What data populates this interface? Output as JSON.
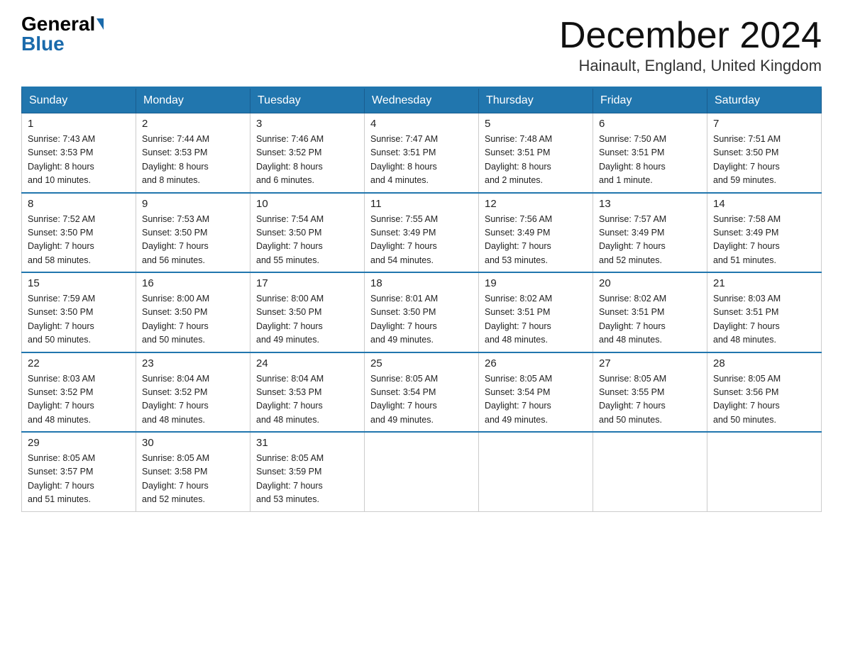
{
  "header": {
    "logo_general": "General",
    "logo_blue": "Blue",
    "title": "December 2024",
    "subtitle": "Hainault, England, United Kingdom"
  },
  "weekdays": [
    "Sunday",
    "Monday",
    "Tuesday",
    "Wednesday",
    "Thursday",
    "Friday",
    "Saturday"
  ],
  "weeks": [
    [
      {
        "day": "1",
        "sunrise": "7:43 AM",
        "sunset": "3:53 PM",
        "daylight": "8 hours and 10 minutes."
      },
      {
        "day": "2",
        "sunrise": "7:44 AM",
        "sunset": "3:53 PM",
        "daylight": "8 hours and 8 minutes."
      },
      {
        "day": "3",
        "sunrise": "7:46 AM",
        "sunset": "3:52 PM",
        "daylight": "8 hours and 6 minutes."
      },
      {
        "day": "4",
        "sunrise": "7:47 AM",
        "sunset": "3:51 PM",
        "daylight": "8 hours and 4 minutes."
      },
      {
        "day": "5",
        "sunrise": "7:48 AM",
        "sunset": "3:51 PM",
        "daylight": "8 hours and 2 minutes."
      },
      {
        "day": "6",
        "sunrise": "7:50 AM",
        "sunset": "3:51 PM",
        "daylight": "8 hours and 1 minute."
      },
      {
        "day": "7",
        "sunrise": "7:51 AM",
        "sunset": "3:50 PM",
        "daylight": "7 hours and 59 minutes."
      }
    ],
    [
      {
        "day": "8",
        "sunrise": "7:52 AM",
        "sunset": "3:50 PM",
        "daylight": "7 hours and 58 minutes."
      },
      {
        "day": "9",
        "sunrise": "7:53 AM",
        "sunset": "3:50 PM",
        "daylight": "7 hours and 56 minutes."
      },
      {
        "day": "10",
        "sunrise": "7:54 AM",
        "sunset": "3:50 PM",
        "daylight": "7 hours and 55 minutes."
      },
      {
        "day": "11",
        "sunrise": "7:55 AM",
        "sunset": "3:49 PM",
        "daylight": "7 hours and 54 minutes."
      },
      {
        "day": "12",
        "sunrise": "7:56 AM",
        "sunset": "3:49 PM",
        "daylight": "7 hours and 53 minutes."
      },
      {
        "day": "13",
        "sunrise": "7:57 AM",
        "sunset": "3:49 PM",
        "daylight": "7 hours and 52 minutes."
      },
      {
        "day": "14",
        "sunrise": "7:58 AM",
        "sunset": "3:49 PM",
        "daylight": "7 hours and 51 minutes."
      }
    ],
    [
      {
        "day": "15",
        "sunrise": "7:59 AM",
        "sunset": "3:50 PM",
        "daylight": "7 hours and 50 minutes."
      },
      {
        "day": "16",
        "sunrise": "8:00 AM",
        "sunset": "3:50 PM",
        "daylight": "7 hours and 50 minutes."
      },
      {
        "day": "17",
        "sunrise": "8:00 AM",
        "sunset": "3:50 PM",
        "daylight": "7 hours and 49 minutes."
      },
      {
        "day": "18",
        "sunrise": "8:01 AM",
        "sunset": "3:50 PM",
        "daylight": "7 hours and 49 minutes."
      },
      {
        "day": "19",
        "sunrise": "8:02 AM",
        "sunset": "3:51 PM",
        "daylight": "7 hours and 48 minutes."
      },
      {
        "day": "20",
        "sunrise": "8:02 AM",
        "sunset": "3:51 PM",
        "daylight": "7 hours and 48 minutes."
      },
      {
        "day": "21",
        "sunrise": "8:03 AM",
        "sunset": "3:51 PM",
        "daylight": "7 hours and 48 minutes."
      }
    ],
    [
      {
        "day": "22",
        "sunrise": "8:03 AM",
        "sunset": "3:52 PM",
        "daylight": "7 hours and 48 minutes."
      },
      {
        "day": "23",
        "sunrise": "8:04 AM",
        "sunset": "3:52 PM",
        "daylight": "7 hours and 48 minutes."
      },
      {
        "day": "24",
        "sunrise": "8:04 AM",
        "sunset": "3:53 PM",
        "daylight": "7 hours and 48 minutes."
      },
      {
        "day": "25",
        "sunrise": "8:05 AM",
        "sunset": "3:54 PM",
        "daylight": "7 hours and 49 minutes."
      },
      {
        "day": "26",
        "sunrise": "8:05 AM",
        "sunset": "3:54 PM",
        "daylight": "7 hours and 49 minutes."
      },
      {
        "day": "27",
        "sunrise": "8:05 AM",
        "sunset": "3:55 PM",
        "daylight": "7 hours and 50 minutes."
      },
      {
        "day": "28",
        "sunrise": "8:05 AM",
        "sunset": "3:56 PM",
        "daylight": "7 hours and 50 minutes."
      }
    ],
    [
      {
        "day": "29",
        "sunrise": "8:05 AM",
        "sunset": "3:57 PM",
        "daylight": "7 hours and 51 minutes."
      },
      {
        "day": "30",
        "sunrise": "8:05 AM",
        "sunset": "3:58 PM",
        "daylight": "7 hours and 52 minutes."
      },
      {
        "day": "31",
        "sunrise": "8:05 AM",
        "sunset": "3:59 PM",
        "daylight": "7 hours and 53 minutes."
      },
      null,
      null,
      null,
      null
    ]
  ],
  "labels": {
    "sunrise": "Sunrise:",
    "sunset": "Sunset:",
    "daylight": "Daylight:"
  }
}
